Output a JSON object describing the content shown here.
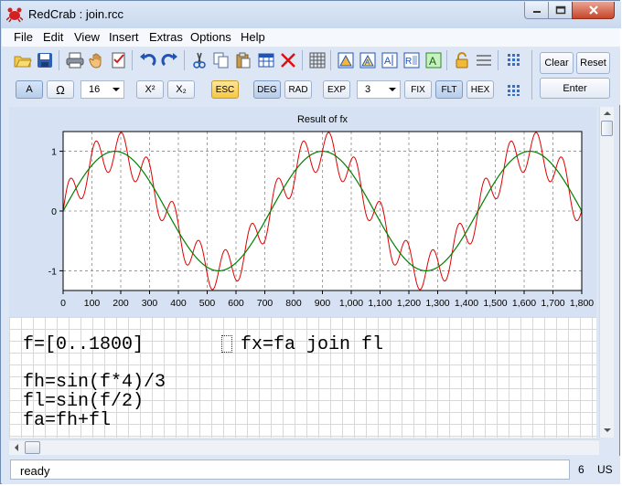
{
  "window": {
    "title": "RedCrab : join.rcc",
    "accent": "#6d8bb3"
  },
  "menu": {
    "items": [
      "File",
      "Edit",
      "View",
      "Insert",
      "Extras",
      "Options",
      "Help"
    ]
  },
  "toolbar": {
    "row1_icons": [
      "open-folder-icon",
      "save-icon",
      "print-icon",
      "hand-icon",
      "checklist-icon",
      "undo-icon",
      "redo-icon",
      "cut-icon",
      "copy-icon",
      "paste-icon",
      "table-icon",
      "delete-icon",
      "grid-icon",
      "chart-a-icon",
      "chart-b-icon",
      "chart-c-icon",
      "chart-d-icon",
      "chart-e-icon",
      "lock-icon",
      "lines-icon",
      "dots-grid-icon"
    ],
    "clear_label": "Clear",
    "reset_label": "Reset",
    "enter_label": "Enter",
    "font_button_label": "A",
    "omega_label": "Ω",
    "font_size": "16",
    "superscript_label": "X²",
    "subscript_label": "X₂",
    "esc_label": "ESC",
    "deg_label": "DEG",
    "rad_label": "RAD",
    "exp_label": "EXP",
    "precision": "3",
    "fix_label": "FIX",
    "flt_label": "FLT",
    "hex_label": "HEX"
  },
  "chart_data": {
    "type": "line",
    "title": "Result of fx",
    "xlim": [
      0,
      1800
    ],
    "ylim": [
      -1.33,
      1.33
    ],
    "x_ticks": [
      0,
      100,
      200,
      300,
      400,
      500,
      600,
      700,
      800,
      900,
      1000,
      1100,
      1200,
      1300,
      1400,
      1500,
      1600,
      1700,
      1800
    ],
    "x_tick_labels": [
      "0",
      "100",
      "200",
      "300",
      "400",
      "500",
      "600",
      "700",
      "800",
      "900",
      "1,000",
      "1,100",
      "1,200",
      "1,300",
      "1,400",
      "1,500",
      "1,600",
      "1,700",
      "1,800"
    ],
    "y_ticks": [
      -1,
      0,
      1
    ],
    "y_tick_labels": [
      "-1",
      "0",
      "1"
    ],
    "grid": true,
    "series": [
      {
        "formula": "fl=sin(f/2)",
        "color": "#008000"
      },
      {
        "formula": "fa=fh+fl",
        "color": "#e00000"
      }
    ]
  },
  "worksheet": {
    "lines": [
      "f=[0..1800]",
      "fx=fa join fl",
      "fh=sin(f*4)/3",
      "fl=sin(f/2)",
      "fa=fh+fl"
    ]
  },
  "status": {
    "text": "ready",
    "number": "6",
    "lang": "US"
  }
}
